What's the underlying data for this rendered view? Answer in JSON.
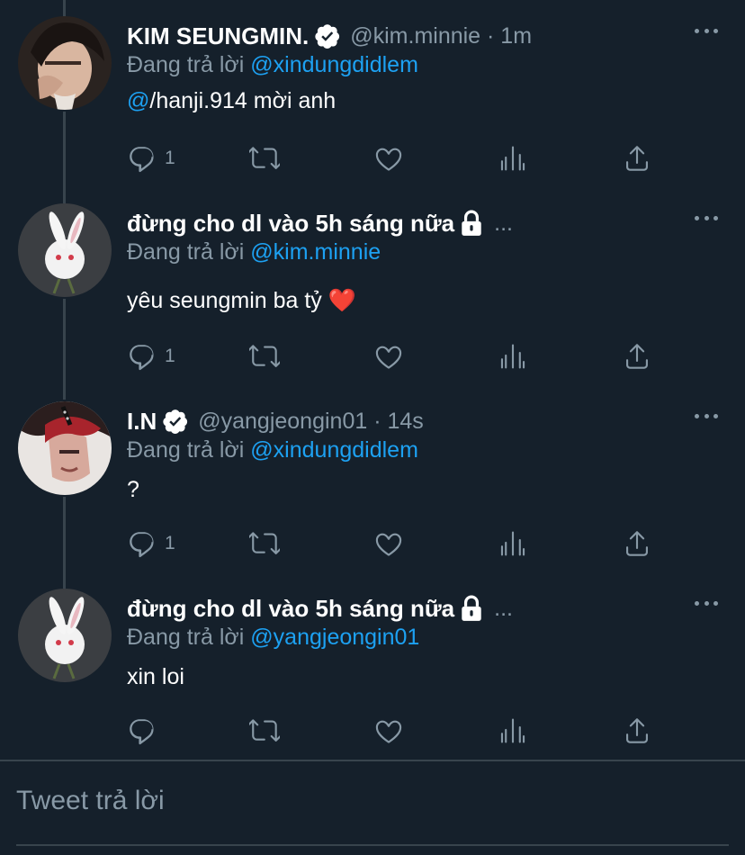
{
  "tweets": [
    {
      "name": "KIM SEUNGMIN.",
      "verified": true,
      "handle": "@kim.minnie · 1m",
      "reply_label": "Đang trả lời",
      "reply_to": "@xindungdidlem",
      "text_mention": "@",
      "text_rest": "/hanji.914 mời anh",
      "reply_count": "1",
      "avatar": "person-photo"
    },
    {
      "name": "đừng cho dl vào 5h sáng nữa",
      "locked": true,
      "handle": "...",
      "reply_label": "Đang trả lời",
      "reply_to": "@kim.minnie",
      "text": "yêu seungmin ba tỷ ❤️",
      "reply_count": "1",
      "avatar": "bunny-photo"
    },
    {
      "name": "I.N",
      "verified": true,
      "handle": "@yangjeongin01 · 14s",
      "reply_label": "Đang trả lời",
      "reply_to": "@xindungdidlem",
      "text": "?",
      "reply_count": "1",
      "avatar": "person-photo-red"
    },
    {
      "name": "đừng cho dl vào 5h sáng nữa",
      "locked": true,
      "handle": "...",
      "reply_label": "Đang trả lời",
      "reply_to": "@yangjeongin01",
      "text": "xin loi",
      "reply_count": "",
      "avatar": "bunny-photo"
    }
  ],
  "compose": {
    "placeholder": "Tweet trả lời"
  },
  "colors": {
    "background": "#15202b",
    "secondary_text": "#8899a6",
    "link": "#1da1f2",
    "divider": "#38444d"
  }
}
